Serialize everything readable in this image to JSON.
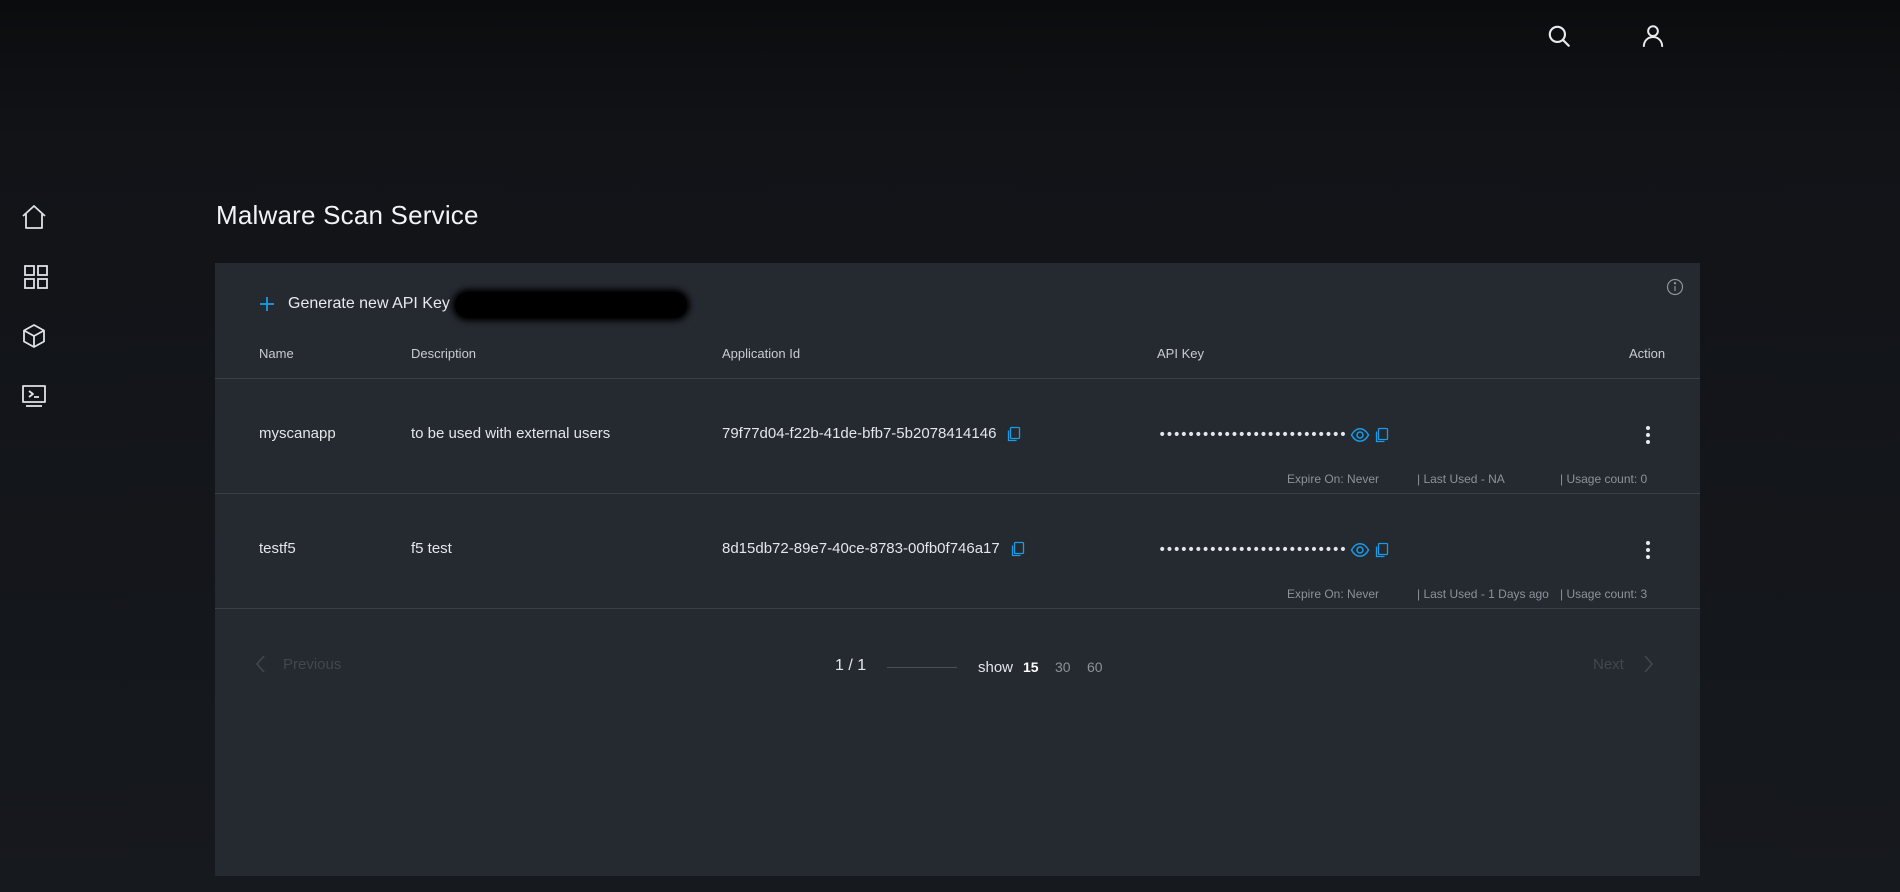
{
  "header": {
    "search_icon": "search-icon",
    "user_icon": "user-icon"
  },
  "sidebar": {
    "items": [
      {
        "name": "home",
        "icon": "home-icon"
      },
      {
        "name": "apps",
        "icon": "grid-icon"
      },
      {
        "name": "packages",
        "icon": "cube-icon"
      },
      {
        "name": "console",
        "icon": "terminal-icon"
      }
    ]
  },
  "page": {
    "title": "Malware Scan Service"
  },
  "toolbar": {
    "generate_label": "Generate new API Key"
  },
  "table": {
    "columns": [
      "Name",
      "Description",
      "Application Id",
      "API Key",
      "Action"
    ],
    "rows": [
      {
        "name": "myscanapp",
        "description": "to be used with external users",
        "app_id": "79f77d04-f22b-41de-bfb7-5b2078414146",
        "api_key_masked": "••••••••••••••••••••••••••",
        "expire": "Expire On: Never",
        "last_used": "| Last Used - NA",
        "usage": "| Usage count: 0"
      },
      {
        "name": "testf5",
        "description": "f5 test",
        "app_id": "8d15db72-89e7-40ce-8783-00fb0f746a17",
        "api_key_masked": "••••••••••••••••••••••••••",
        "expire": "Expire On: Never",
        "last_used": "| Last Used - 1 Days ago",
        "usage": "| Usage count: 3"
      }
    ]
  },
  "pagination": {
    "previous": "Previous",
    "next": "Next",
    "page_count": "1 / 1",
    "show_label": "show",
    "sizes": [
      "15",
      "30",
      "60"
    ],
    "selected_size": "15"
  },
  "colors": {
    "accent": "#1a9be6",
    "panel": "#252930",
    "background": "#111317"
  }
}
